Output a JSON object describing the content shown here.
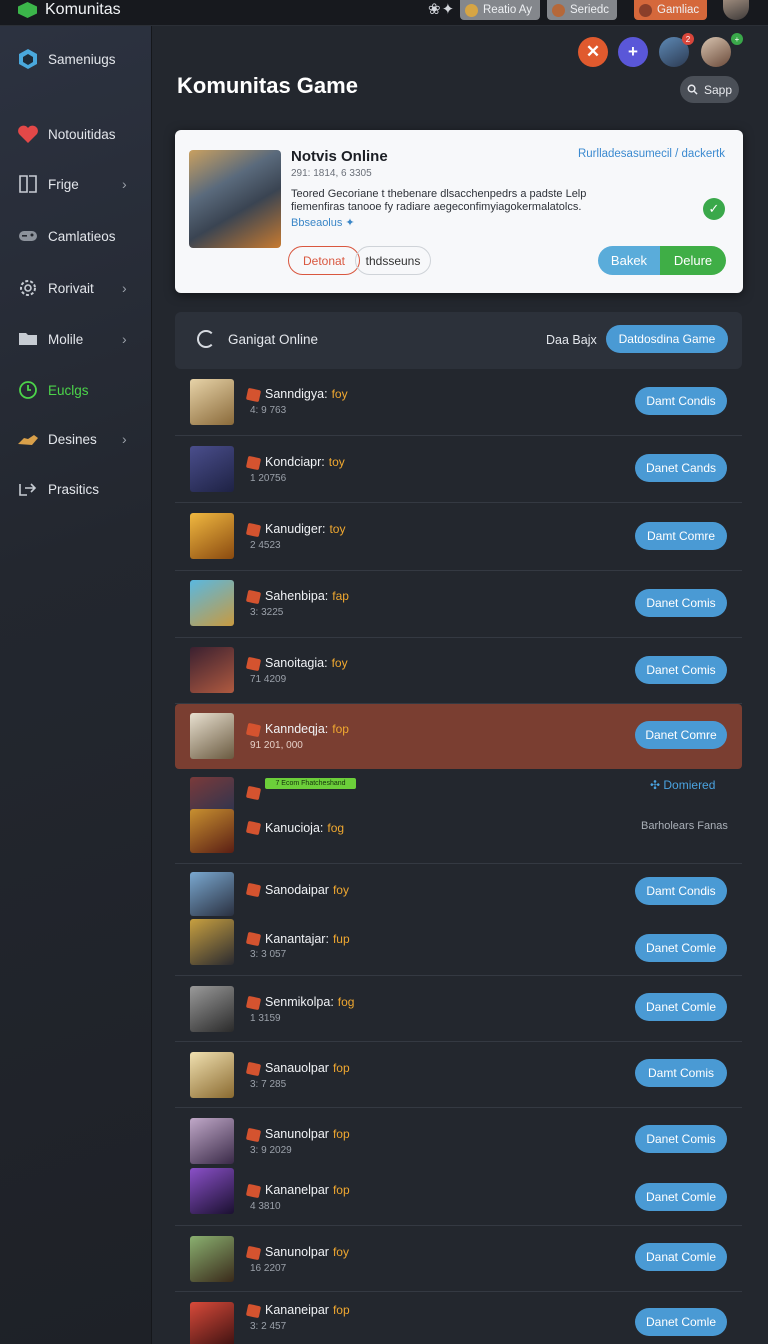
{
  "topbar": {
    "app_name": "Komunitas",
    "glyph": "❀✦",
    "pills": [
      {
        "label": "Reatio Ay",
        "color": "#8b8e93"
      },
      {
        "label": "Seriedc",
        "color": "#8b8e93"
      },
      {
        "label": "Gamliac",
        "color": "#d96a3b"
      }
    ]
  },
  "sidebar": {
    "items": [
      {
        "label": "Sameniugs",
        "icon": "hexagon-icon",
        "color": "#5fb7e6",
        "chevron": false,
        "active": false
      },
      {
        "label": "Notouitidas",
        "icon": "heart-icon",
        "color": "#e84b4b",
        "chevron": false,
        "active": false
      },
      {
        "label": "Frige",
        "icon": "book-icon",
        "color": "#c7ccd3",
        "chevron": true,
        "active": false
      },
      {
        "label": "Camlatieos",
        "icon": "gamepad-icon",
        "color": "#c7ccd3",
        "chevron": false,
        "active": false
      },
      {
        "label": "Rorivait",
        "icon": "gear-icon",
        "color": "#c7ccd3",
        "chevron": true,
        "active": false
      },
      {
        "label": "Molile",
        "icon": "folder-icon",
        "color": "#c7ccd3",
        "chevron": true,
        "active": false
      },
      {
        "label": "Euclgs",
        "icon": "clock-icon",
        "color": "#4cd44a",
        "chevron": false,
        "active": true
      },
      {
        "label": "Desines",
        "icon": "hand-icon",
        "color": "#e2a44a",
        "chevron": true,
        "active": false
      },
      {
        "label": "Prasitics",
        "icon": "share-icon",
        "color": "#c7ccd3",
        "chevron": false,
        "active": false
      }
    ]
  },
  "header": {
    "title": "Komunitas Game",
    "search_label": "Sapp",
    "badges": [
      "2",
      "+"
    ]
  },
  "notice": {
    "title": "Notvis Online",
    "meta": "291: 1814, 6 3305",
    "body": "Teored Gecoriane t thebenare dlsacchenpedrs a padste Lelp fiemenfiras tanooe fy radiare aegeconfimyiagokermalatolcs.",
    "link": "Bbseaolus ✦",
    "crumb": "Rurlladesasumecil / dackertk",
    "btn_outline": "Detonat",
    "btn_plain": "thdsseuns",
    "btn_blue": "Bakek",
    "btn_green": "Delure"
  },
  "list_header": {
    "title": "Ganigat Online",
    "right_label": "Daa Bajx",
    "button": "Datdosdina Game"
  },
  "rows": [
    {
      "name": "Sanndigya:",
      "tag": "foy",
      "sub": "4: 9 763",
      "action": "Damt Condis"
    },
    {
      "name": "Kondciapr:",
      "tag": "toy",
      "sub": "1 20756",
      "action": "Danet Cands"
    },
    {
      "name": "Kanudiger:",
      "tag": "toy",
      "sub": "2 4523",
      "action": "Damt Comre"
    },
    {
      "name": "Sahenbipa:",
      "tag": "fap",
      "sub": "3: 3225",
      "action": "Danet Comis"
    },
    {
      "name": "Sanoitagia:",
      "tag": "foy",
      "sub": "71 4209",
      "action": "Danet Comis"
    },
    {
      "name": "Kanndeqja:",
      "tag": "fop",
      "sub": "91 201, 000",
      "action": "Danet Comre"
    },
    {
      "name": "Kanucioja:",
      "tag": "fog",
      "sub": "",
      "banner": "7 Ecom Fhatcheshand",
      "link": "✣ Domiered",
      "note": "Barholears Fanas"
    },
    {
      "name": "Sanodaipar",
      "tag": "foy",
      "sub": "",
      "action": "Damt Condis"
    },
    {
      "name": "Kanantajar:",
      "tag": "fup",
      "sub": "3: 3 057",
      "action": "Danet Comle"
    },
    {
      "name": "Senmikolpa:",
      "tag": "fog",
      "sub": "1 3159",
      "action": "Danet Comle"
    },
    {
      "name": "Sanauolpar",
      "tag": "fop",
      "sub": "3: 7 285",
      "action": "Damt Comis"
    },
    {
      "name": "Sanunolpar",
      "tag": "fop",
      "sub": "3: 9 2029",
      "action": "Danet Comis"
    },
    {
      "name": "Kananelpar",
      "tag": "fop",
      "sub": "4 3810",
      "action": "Danet Comle"
    },
    {
      "name": "Sanunolpar",
      "tag": "foy",
      "sub": "16 2207",
      "action": "Danat Comle"
    },
    {
      "name": "Kananeipar",
      "tag": "fop",
      "sub": "3: 2 457",
      "action": "Danet Comle"
    }
  ]
}
